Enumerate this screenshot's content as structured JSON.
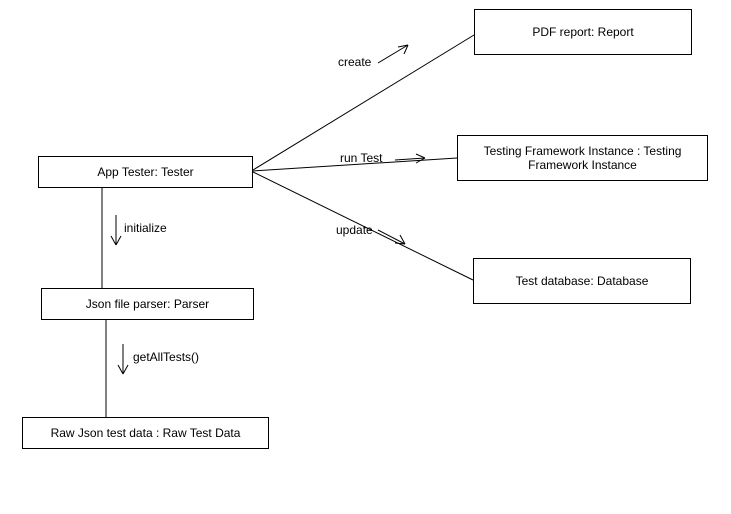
{
  "chart_data": {
    "type": "diagram",
    "title": "",
    "nodes": [
      {
        "id": "tester",
        "label": "App Tester: Tester"
      },
      {
        "id": "parser",
        "label": "Json file parser: Parser"
      },
      {
        "id": "rawdata",
        "label": "Raw Json test data : Raw Test Data"
      },
      {
        "id": "report",
        "label": "PDF report: Report"
      },
      {
        "id": "framework",
        "label": "Testing Framework Instance : Testing Framework Instance"
      },
      {
        "id": "database",
        "label": "Test database: Database"
      }
    ],
    "edges": [
      {
        "from": "tester",
        "to": "report",
        "label": "create"
      },
      {
        "from": "tester",
        "to": "framework",
        "label": "run Test"
      },
      {
        "from": "tester",
        "to": "database",
        "label": "update"
      },
      {
        "from": "tester",
        "to": "parser",
        "label": "initialize"
      },
      {
        "from": "parser",
        "to": "rawdata",
        "label": "getAllTests()"
      }
    ]
  },
  "boxes": {
    "tester": "App Tester: Tester",
    "parser": "Json file parser: Parser",
    "rawdata": "Raw Json test data : Raw Test Data",
    "report": "PDF report: Report",
    "framework": "Testing Framework Instance : Testing Framework Instance",
    "database": "Test database: Database"
  },
  "labels": {
    "create": "create",
    "runtest": "run Test",
    "update": "update",
    "initialize": "initialize",
    "getalltests": "getAllTests()"
  }
}
